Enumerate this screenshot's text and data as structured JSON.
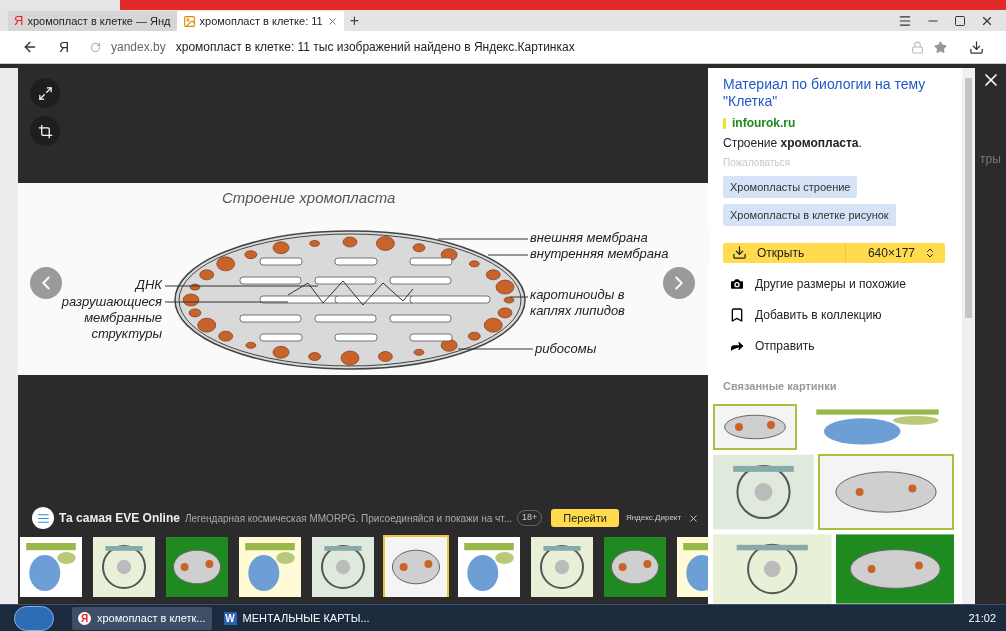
{
  "browser": {
    "tabs": [
      {
        "title": "хромопласт в клетке — Янд",
        "icon": "Я",
        "selected": false
      },
      {
        "title": "хромопласт в клетке: 11",
        "selected": true
      }
    ],
    "new_tab": "+"
  },
  "address_bar": {
    "logo": "Я",
    "domain": "yandex.by",
    "page_title": "хромопласт в клетке: 11 тыс изображений найдено в Яндекс.Картинках"
  },
  "diagram": {
    "title": "Строение  хромопласта",
    "labels": [
      {
        "text": "внешняя мембрана"
      },
      {
        "text": "внутренняя мембрана"
      },
      {
        "text": "ДНК"
      },
      {
        "text": "разрушающиеся мембранные структуры"
      },
      {
        "text": "каротиноиды в каплях липидов"
      },
      {
        "text": "рибосомы"
      }
    ]
  },
  "ad": {
    "title": "Та самая EVE Online",
    "text": "Легендарная космическая MMORPG. Присоединяйся и покажи на чт...",
    "age": "18+",
    "button": "Перейти",
    "source": "Яндекс.Директ"
  },
  "thumbnails": [
    {
      "selected": false
    },
    {
      "selected": false
    },
    {
      "selected": false
    },
    {
      "selected": false
    },
    {
      "selected": false
    },
    {
      "selected": true
    },
    {
      "selected": false
    },
    {
      "selected": false
    },
    {
      "selected": false
    },
    {
      "selected": false
    }
  ],
  "panel": {
    "title": "Материал по биологии на тему \"Клетка\"",
    "site": "infourok.ru",
    "description": "Строение **хромопласта**.",
    "report": "Пожаловаться",
    "tags": [
      "Хромопласты строение",
      "Хромопласты в клетке рисунок"
    ],
    "open_button": {
      "label": "Открыть",
      "size": "640×177"
    },
    "actions": [
      {
        "kind": "camera",
        "label": "Другие размеры и похожие"
      },
      {
        "kind": "bookmark",
        "label": "Добавить в коллекцию"
      },
      {
        "kind": "share",
        "label": "Отправить"
      }
    ],
    "related_title": "Связанные картинки"
  },
  "background_text": "тры",
  "taskbar": {
    "tasks": [
      {
        "icon": "Я",
        "label": "хромопласт в клетк...",
        "selected": true
      },
      {
        "icon": "W",
        "label": "МЕНТАЛЬНЫЕ КАРТЫ...",
        "selected": false
      }
    ],
    "clock": "21:02"
  }
}
